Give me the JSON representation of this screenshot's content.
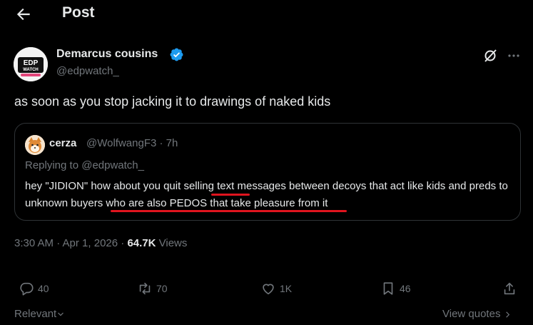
{
  "header": {
    "title": "Post"
  },
  "post": {
    "author_name": "Demarcus cousins",
    "handle": "@edpwatch_",
    "avatar_text_top": "EDP",
    "avatar_text_bottom": "WATCH",
    "text": "as soon as you stop jacking it to drawings of naked kids"
  },
  "quote": {
    "name": "cerza",
    "handle_time": "@WolfwangF3 · 7h",
    "replying_to": "Replying to @edpwatch_",
    "text_parts": [
      "hey \"JIDION\" how about you quit ",
      "selling",
      " text messages between decoys that act like kids and preds ",
      "to unknown buyers who are also PEDOS",
      " that take pleasure from it"
    ]
  },
  "meta": {
    "time_date": "3:30 AM · Apr 1, 2026 · ",
    "views_count": "64.7K",
    "views_label": " Views"
  },
  "actions": {
    "replies": "40",
    "reposts": "70",
    "likes": "1K",
    "bookmarks": "46"
  },
  "footer": {
    "relevant": "Relevant",
    "view_quotes": "View quotes"
  },
  "colors": {
    "background": "#000000",
    "text": "#e7e9ea",
    "muted": "#71767b",
    "verified": "#1d9bf0",
    "annotation": "#e0141e"
  }
}
